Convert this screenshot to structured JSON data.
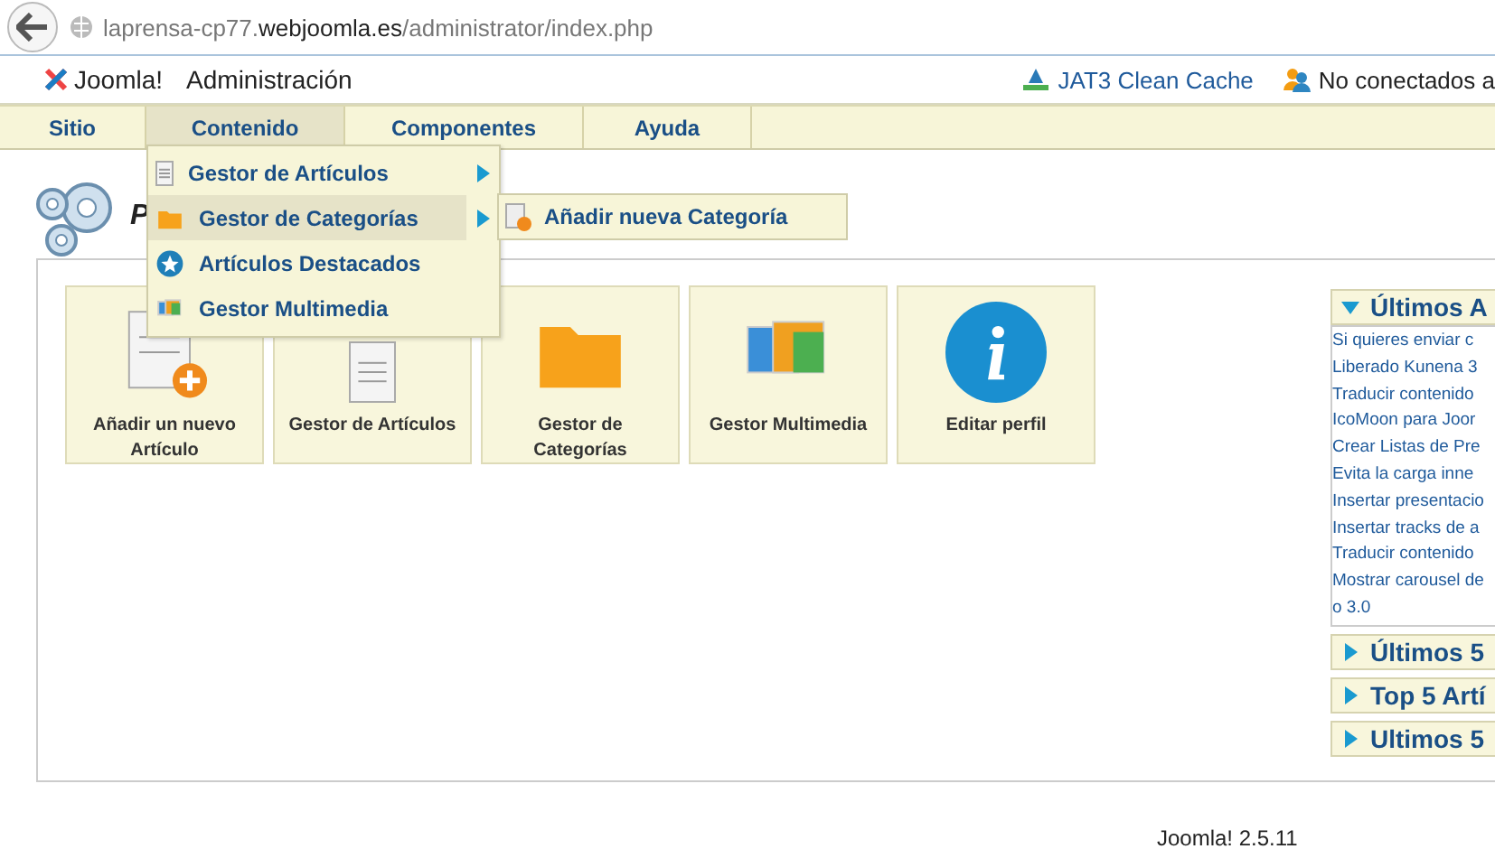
{
  "browser": {
    "url_host": "laprensa-cp77.",
    "url_domain": "webjoomla.es",
    "url_path": "/administrator/index.php"
  },
  "header": {
    "logo": "Joomla!",
    "title": "Administración",
    "links": [
      {
        "kind": "cache",
        "label": "JAT3 Clean Cache"
      },
      {
        "kind": "users",
        "label": "No conectados a"
      }
    ]
  },
  "menu": [
    {
      "label": "Sitio",
      "selected": false
    },
    {
      "label": "Contenido",
      "selected": true
    },
    {
      "label": "Componentes",
      "selected": false
    },
    {
      "label": "Ayuda",
      "selected": false
    }
  ],
  "dropdown": [
    {
      "kind": "articles",
      "label": "Gestor de Artículos",
      "submenu": true,
      "selected": false
    },
    {
      "kind": "folder",
      "label": "Gestor de Categorías",
      "submenu": true,
      "selected": true
    },
    {
      "kind": "star",
      "label": "Artículos Destacados",
      "submenu": false,
      "selected": false
    },
    {
      "kind": "media",
      "label": "Gestor Multimedia",
      "submenu": false,
      "selected": false
    }
  ],
  "submenu": [
    {
      "label": "Añadir nueva Categoría"
    }
  ],
  "page_title": "P",
  "tiles": [
    {
      "kind": "new-article",
      "label": "Añadir un nuevo Artículo"
    },
    {
      "kind": "articles",
      "label": "Gestor de Artículos"
    },
    {
      "kind": "folder",
      "label": "Gestor de Categorías"
    },
    {
      "kind": "media",
      "label": "Gestor Multimedia"
    },
    {
      "kind": "info",
      "label": "Editar perfil"
    }
  ],
  "panels": [
    {
      "title": "Últimos A",
      "expanded": true,
      "items": [
        "Si quieres enviar c",
        "Liberado Kunena 3",
        "Traducir contenido",
        "IcoMoon para Joor",
        "Crear Listas de Pre",
        "Evita la carga inne",
        "Insertar presentacio",
        "Insertar tracks de a",
        "Traducir contenido",
        "Mostrar carousel de",
        "o 3.0"
      ]
    },
    {
      "title": "Últimos 5",
      "expanded": false
    },
    {
      "title": "Top 5 Artí",
      "expanded": false
    },
    {
      "title": "Ultimos 5",
      "expanded": false
    }
  ],
  "footer": "Joomla! 2.5.11"
}
